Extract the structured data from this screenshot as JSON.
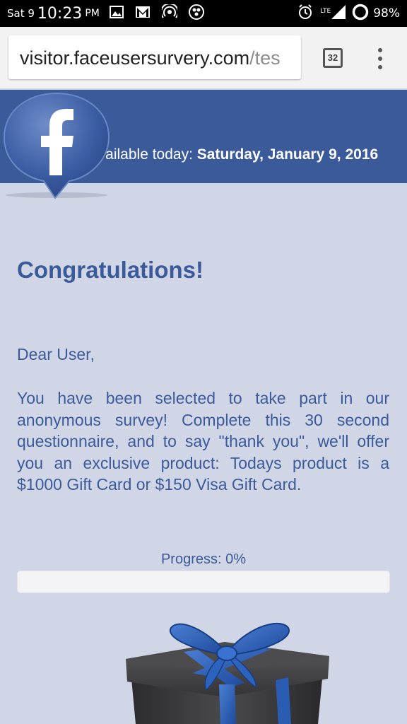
{
  "status_bar": {
    "date": "Sat 9",
    "time": "10:23",
    "ampm": "PM",
    "network": "LTE",
    "battery": "98%",
    "icons": [
      "image-icon",
      "gmail-icon",
      "hotspot-icon",
      "apps-icon",
      "alarm-icon",
      "signal-icon",
      "battery-icon"
    ]
  },
  "browser": {
    "url_host": "visitor.faceusersurvery.com",
    "url_path": "/tes",
    "tab_count": "32",
    "menu_icon": "overflow-menu-icon"
  },
  "header": {
    "offer_prefix": "This offer is available today:",
    "offer_date": "Saturday, January 9, 2016",
    "logo_icon": "facebook-logo-icon",
    "brand_color": "#3b5a9a"
  },
  "main": {
    "title": "Congratulations!",
    "greeting": "Dear User,",
    "message": "You have been selected to take part in our anonymous survey! Complete this 30 second questionnaire, and to say \"thank you\", we'll offer you an exclusive product: Todays product is a $1000 Gift Card or $150 Visa Gift Card.",
    "progress_label": "Progress: 0%",
    "progress_value": 0,
    "gift_icon": "gift-box-icon"
  }
}
